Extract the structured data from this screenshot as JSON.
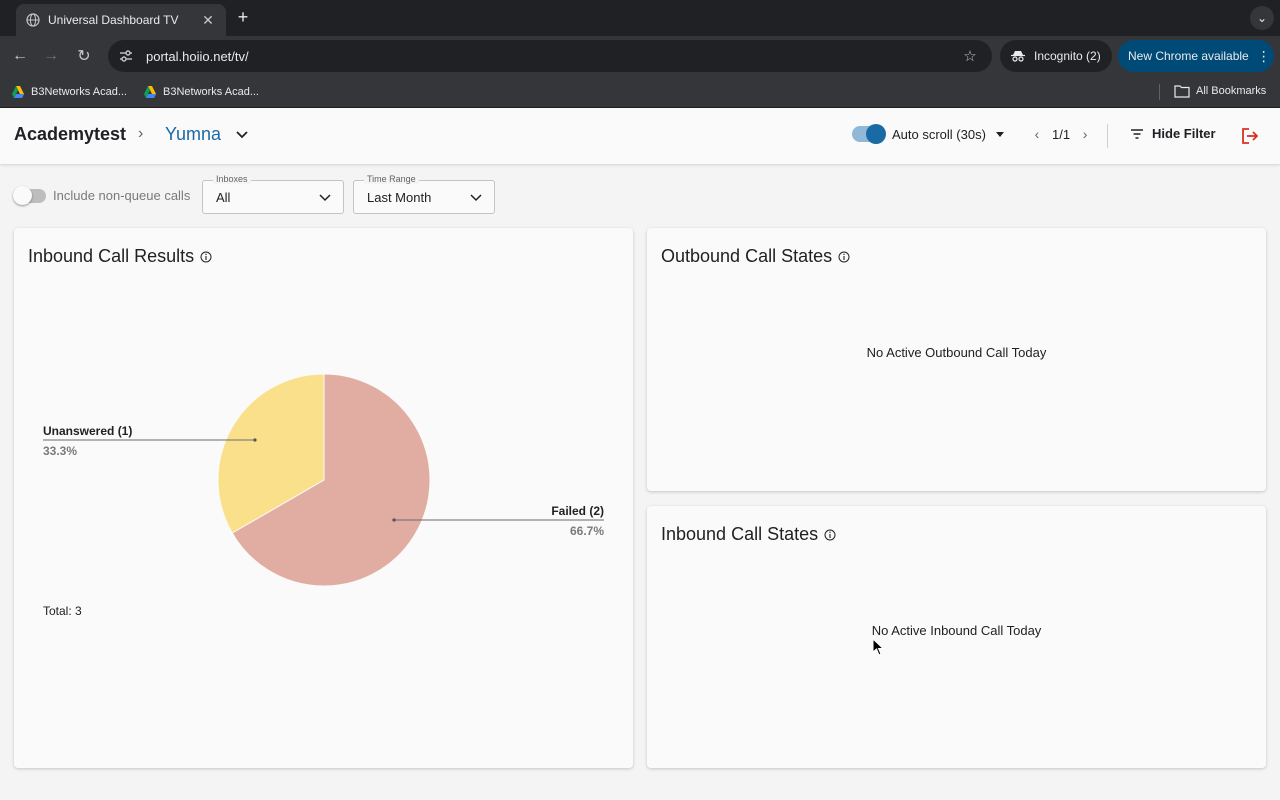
{
  "browser": {
    "tab_title": "Universal Dashboard TV",
    "url": "portal.hoiio.net/tv/",
    "incognito_label": "Incognito (2)",
    "update_label": "New Chrome available",
    "bookmarks": [
      "B3Networks Acad...",
      "B3Networks Acad..."
    ],
    "all_bookmarks": "All Bookmarks"
  },
  "header": {
    "org": "Academytest",
    "user": "Yumna",
    "autoscroll_label": "Auto scroll (30s)",
    "page_indicator": "1/1",
    "hide_filter_label": "Hide Filter",
    "logout_color": "#d93025",
    "accent": "#1a6aa6"
  },
  "filters": {
    "non_queue_label": "Include non-queue calls",
    "inboxes": {
      "legend": "Inboxes",
      "value": "All"
    },
    "time_range": {
      "legend": "Time Range",
      "value": "Last Month"
    }
  },
  "cards": {
    "inbound_results": {
      "title": "Inbound Call Results",
      "total": "Total: 3"
    },
    "outbound_states": {
      "title": "Outbound Call States",
      "empty": "No Active Outbound Call Today"
    },
    "inbound_states": {
      "title": "Inbound Call States",
      "empty": "No Active Inbound Call Today"
    }
  },
  "chart_data": {
    "type": "pie",
    "slices": [
      {
        "label": "Failed (2)",
        "value": 2,
        "percent": "66.7%",
        "color": "#e1aca2"
      },
      {
        "label": "Unanswered (1)",
        "value": 1,
        "percent": "33.3%",
        "color": "#fbe08c"
      }
    ]
  }
}
